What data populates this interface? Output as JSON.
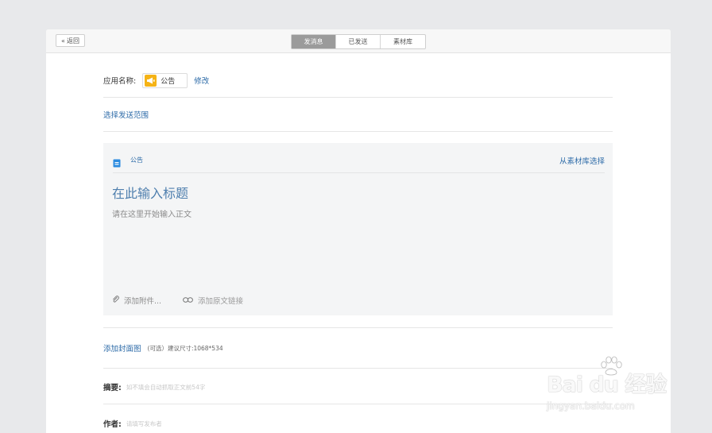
{
  "topbar": {
    "back_label": "返回",
    "tabs": [
      {
        "label": "发消息",
        "active": true
      },
      {
        "label": "已发送",
        "active": false
      },
      {
        "label": "素材库",
        "active": false
      }
    ]
  },
  "app": {
    "label": "应用名称:",
    "name": "公告",
    "edit_label": "修改",
    "icon": "megaphone-icon",
    "icon_color": "#f5b316"
  },
  "scope": {
    "label": "选择发送范围"
  },
  "editor": {
    "type_label": "公告",
    "pick_from_library": "从素材库选择",
    "title_placeholder": "在此输入标题",
    "body_placeholder": "请在这里开始输入正文",
    "attach_label": "添加附件...",
    "origin_link_label": "添加原文链接"
  },
  "cover": {
    "label": "添加封面图",
    "hint": "(可选）建议尺寸:1068*534"
  },
  "summary": {
    "label": "摘要:",
    "placeholder": "如不填会自动抓取正文前54字"
  },
  "author": {
    "label": "作者:",
    "placeholder": "请填写发布者"
  },
  "watermark": {
    "main": "Bai du 经验",
    "sub": "jingyan.baidu.com"
  },
  "colors": {
    "accent": "#2d6ba8",
    "active_tab": "#9b9b9b",
    "background": "#e8e9eb"
  }
}
